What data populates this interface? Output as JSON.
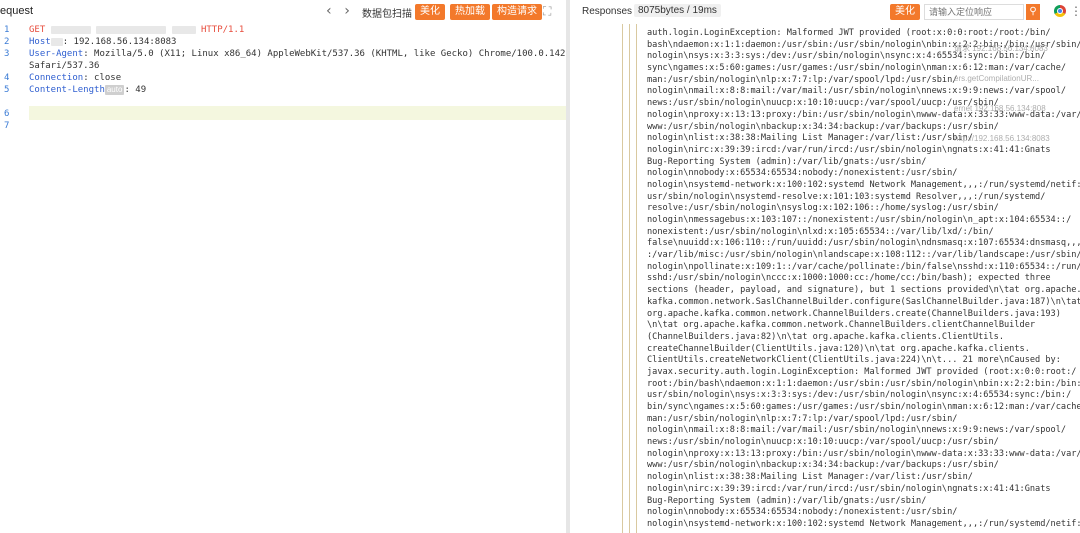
{
  "request": {
    "title": "equest",
    "nav_prev": "‹",
    "nav_next": "›",
    "capture_label": "数据包扫描",
    "beautify_label": "美化",
    "hot_load_label": "热加载",
    "build_label": "构造请求",
    "line_numbers": [
      "1",
      "2",
      "3",
      "4",
      "5",
      "6",
      "7"
    ],
    "lines": {
      "l1_method": "GET",
      "l1_proto": "HTTP/1.1",
      "l2_key": "Host",
      "l2_value": ": 192.168.56.134:8083",
      "l3_key": "User-Agent",
      "l3_value": ": Mozilla/5.0 (X11; Linux x86_64) AppleWebKit/537.36 (KHTML, like Gecko) Chrome/100.0.1422.109",
      "l4_value": "Safari/537.36",
      "l5_key": "Connection",
      "l5_value": ": close",
      "l6_key": "Content-Length",
      "l6_badge": "auto",
      "l6_value": ": 49"
    }
  },
  "response": {
    "title": "Responses",
    "meta": "8075bytes / 19ms",
    "beautify_label": "美化",
    "search_placeholder": "请输入定位响应",
    "overlay_lines": [
      "请求 192.168.56.134:8083",
      "ers.getCompilationUR...",
      "ernet 192.168.56.134:808",
      "http://192.168.56.134:8083"
    ],
    "lines": [
      "auth.login.LoginException: Malformed JWT provided (root:x:0:0:root:/root:/bin/",
      "bash\\ndaemon:x:1:1:daemon:/usr/sbin:/usr/sbin/nologin\\nbin:x:2:2:bin:/bin:/usr/sbin/",
      "nologin\\nsys:x:3:3:sys:/dev:/usr/sbin/nologin\\nsync:x:4:65534:sync:/bin:/bin/",
      "sync\\ngames:x:5:60:games:/usr/games:/usr/sbin/nologin\\nman:x:6:12:man:/var/cache/",
      "man:/usr/sbin/nologin\\nlp:x:7:7:lp:/var/spool/lpd:/usr/sbin/",
      "nologin\\nmail:x:8:8:mail:/var/mail:/usr/sbin/nologin\\nnews:x:9:9:news:/var/spool/",
      "news:/usr/sbin/nologin\\nuucp:x:10:10:uucp:/var/spool/uucp:/usr/sbin/",
      "nologin\\nproxy:x:13:13:proxy:/bin:/usr/sbin/nologin\\nwww-data:x:33:33:www-data:/var/",
      "www:/usr/sbin/nologin\\nbackup:x:34:34:backup:/var/backups:/usr/sbin/",
      "nologin\\nlist:x:38:38:Mailing List Manager:/var/list:/usr/sbin/",
      "nologin\\nirc:x:39:39:ircd:/var/run/ircd:/usr/sbin/nologin\\ngnats:x:41:41:Gnats",
      "Bug-Reporting System (admin):/var/lib/gnats:/usr/sbin/",
      "nologin\\nnobody:x:65534:65534:nobody:/nonexistent:/usr/sbin/",
      "nologin\\nsystemd-network:x:100:102:systemd Network Management,,,:/run/systemd/netif:/",
      "usr/sbin/nologin\\nsystemd-resolve:x:101:103:systemd Resolver,,,:/run/systemd/",
      "resolve:/usr/sbin/nologin\\nsyslog:x:102:106::/home/syslog:/usr/sbin/",
      "nologin\\nmessagebus:x:103:107::/nonexistent:/usr/sbin/nologin\\n_apt:x:104:65534::/",
      "nonexistent:/usr/sbin/nologin\\nlxd:x:105:65534::/var/lib/lxd/:/bin/",
      "false\\nuuidd:x:106:110::/run/uuidd:/usr/sbin/nologin\\ndnsmasq:x:107:65534:dnsmasq,,,",
      ":/var/lib/misc:/usr/sbin/nologin\\nlandscape:x:108:112::/var/lib/landscape:/usr/sbin/",
      "nologin\\npollinate:x:109:1::/var/cache/pollinate:/bin/false\\nsshd:x:110:65534::/run/",
      "sshd:/usr/sbin/nologin\\nccc:x:1000:1000:cc:/home/cc:/bin/bash); expected three",
      "sections (header, payload, and signature), but 1 sections provided\\n\\tat org.apache.",
      "kafka.common.network.SaslChannelBuilder.configure(SaslChannelBuilder.java:187)\\n\\tat",
      "org.apache.kafka.common.network.ChannelBuilders.create(ChannelBuilders.java:193)",
      "\\n\\tat org.apache.kafka.common.network.ChannelBuilders.clientChannelBuilder",
      "(ChannelBuilders.java:82)\\n\\tat org.apache.kafka.clients.ClientUtils.",
      "createChannelBuilder(ClientUtils.java:120)\\n\\tat org.apache.kafka.clients.",
      "ClientUtils.createNetworkClient(ClientUtils.java:224)\\n\\t... 21 more\\nCaused by:",
      "javax.security.auth.login.LoginException: Malformed JWT provided (root:x:0:0:root:/",
      "root:/bin/bash\\ndaemon:x:1:1:daemon:/usr/sbin:/usr/sbin/nologin\\nbin:x:2:2:bin:/bin:/",
      "usr/sbin/nologin\\nsys:x:3:3:sys:/dev:/usr/sbin/nologin\\nsync:x:4:65534:sync:/bin:/",
      "bin/sync\\ngames:x:5:60:games:/usr/games:/usr/sbin/nologin\\nman:x:6:12:man:/var/cache/",
      "man:/usr/sbin/nologin\\nlp:x:7:7:lp:/var/spool/lpd:/usr/sbin/",
      "nologin\\nmail:x:8:8:mail:/var/mail:/usr/sbin/nologin\\nnews:x:9:9:news:/var/spool/",
      "news:/usr/sbin/nologin\\nuucp:x:10:10:uucp:/var/spool/uucp:/usr/sbin/",
      "nologin\\nproxy:x:13:13:proxy:/bin:/usr/sbin/nologin\\nwww-data:x:33:33:www-data:/var/",
      "www:/usr/sbin/nologin\\nbackup:x:34:34:backup:/var/backups:/usr/sbin/",
      "nologin\\nlist:x:38:38:Mailing List Manager:/var/list:/usr/sbin/",
      "nologin\\nirc:x:39:39:ircd:/var/run/ircd:/usr/sbin/nologin\\ngnats:x:41:41:Gnats",
      "Bug-Reporting System (admin):/var/lib/gnats:/usr/sbin/",
      "nologin\\nnobody:x:65534:65534:nobody:/nonexistent:/usr/sbin/",
      "nologin\\nsystemd-network:x:100:102:systemd Network Management,,,:/run/systemd/netif:/"
    ]
  },
  "colors": {
    "accent": "#f3792b",
    "keyword_red": "#e74c3c",
    "keyword_blue": "#2f5fd0"
  },
  "icons": {
    "expand": "expand-icon",
    "search": "search-icon",
    "browser": "chrome-icon",
    "more": "more-icon"
  }
}
